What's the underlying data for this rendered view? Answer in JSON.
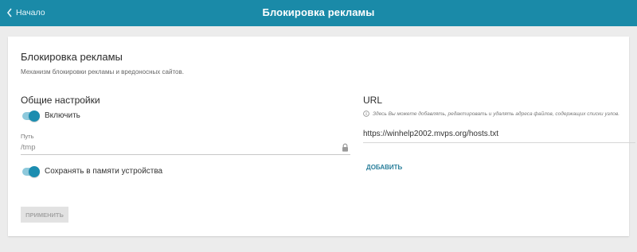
{
  "header": {
    "back_label": "Начало",
    "title": "Блокировка рекламы",
    "bg_color": "#1a8aa8"
  },
  "card": {
    "title": "Блокировка рекламы",
    "description": "Механизм блокировки рекламы и вредоносных сайтов."
  },
  "general": {
    "title": "Общие настройки",
    "enable_toggle": {
      "label": "Включить",
      "checked": true
    },
    "path_field": {
      "label": "Путь",
      "placeholder": "/tmp",
      "value": ""
    },
    "save_toggle": {
      "label": "Сохранять в памяти устройства",
      "checked": true
    },
    "apply_button": "ПРИМЕНИТЬ"
  },
  "url_section": {
    "title": "URL",
    "info_text": "Здесь Вы можете добавлять, редактировать и удалять адреса файлов, содержащих списки узлов.",
    "items": [
      "https://winhelp2002.mvps.org/hosts.txt"
    ],
    "add_label": "ДОБАВИТЬ"
  },
  "colors": {
    "accent": "#1c8db0",
    "toggle_track": "#8ec9dc",
    "link": "#2a7f9b"
  },
  "icons": [
    "chevron-left-icon",
    "lock-icon",
    "info-icon"
  ]
}
